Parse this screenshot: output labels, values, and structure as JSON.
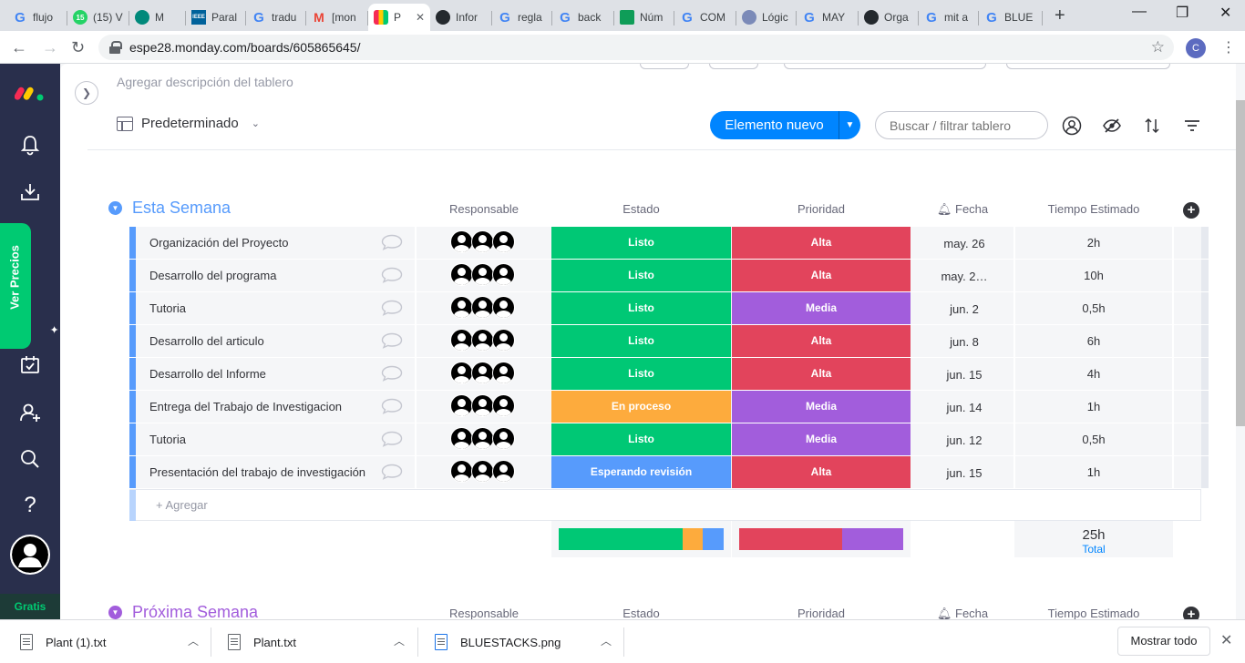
{
  "browser": {
    "tabs": [
      {
        "label": "flujo",
        "icon": "google-icon",
        "glyph": "G",
        "fav": "fav-g"
      },
      {
        "label": "(15) V",
        "icon": "whatsapp-icon",
        "glyph": "15",
        "fav": "fav-wa"
      },
      {
        "label": "M",
        "icon": "chat-icon",
        "glyph": "",
        "fav": "fav-chat"
      },
      {
        "label": "Paral",
        "icon": "ieee-icon",
        "glyph": "IEEE",
        "fav": "fav-ieee"
      },
      {
        "label": "tradu",
        "icon": "google-icon",
        "glyph": "G",
        "fav": "fav-g"
      },
      {
        "label": "[mon",
        "icon": "gmail-icon",
        "glyph": "M",
        "fav": "fav-m"
      },
      {
        "label": "P",
        "icon": "monday-icon",
        "glyph": "",
        "fav": "fav-mon",
        "active": true
      },
      {
        "label": "Infor",
        "icon": "github-icon",
        "glyph": "",
        "fav": "fav-gh"
      },
      {
        "label": "regla",
        "icon": "google-icon",
        "glyph": "G",
        "fav": "fav-g"
      },
      {
        "label": "back",
        "icon": "google-icon",
        "glyph": "G",
        "fav": "fav-g"
      },
      {
        "label": "Núm",
        "icon": "sheets-icon",
        "glyph": "",
        "fav": "fav-sheet"
      },
      {
        "label": "COM",
        "icon": "google-icon",
        "glyph": "G",
        "fav": "fav-g"
      },
      {
        "label": "Lógic",
        "icon": "globe-icon",
        "glyph": "",
        "fav": "fav-globe"
      },
      {
        "label": "MAY",
        "icon": "google-icon",
        "glyph": "G",
        "fav": "fav-g"
      },
      {
        "label": "Orga",
        "icon": "github-icon",
        "glyph": "",
        "fav": "fav-gh"
      },
      {
        "label": "mit a",
        "icon": "google-icon",
        "glyph": "G",
        "fav": "fav-g"
      },
      {
        "label": "BLUE",
        "icon": "google-icon",
        "glyph": "G",
        "fav": "fav-g"
      }
    ],
    "url": "espe28.monday.com/boards/605865645/",
    "profile_initial": "C",
    "new_tab_glyph": "+",
    "minimize_glyph": "—",
    "maximize_glyph": "❐",
    "close_glyph": "✕"
  },
  "sidebar": {
    "upgrade_label": "Ver Precios",
    "plan_label": "Gratis",
    "help_glyph": "?"
  },
  "board": {
    "description_placeholder": "Agregar descripción del tablero",
    "view_name": "Predeterminado",
    "new_item_label": "Elemento nuevo",
    "search_placeholder": "Buscar / filtrar tablero"
  },
  "columns": {
    "owner": "Responsable",
    "status": "Estado",
    "priority": "Prioridad",
    "date": "Fecha",
    "time": "Tiempo Estimado"
  },
  "colors": {
    "status_done": "#00c875",
    "status_working": "#fdab3d",
    "status_waiting": "#579bfc",
    "priority_high": "#e2445c",
    "priority_medium": "#a25ddc",
    "group1": "#579bfc",
    "group2": "#a25ddc"
  },
  "groups": [
    {
      "title": "Esta Semana",
      "add_label": "+ Agregar",
      "rows": [
        {
          "name": "Organización del Proyecto",
          "status": "Listo",
          "status_color": "#00c875",
          "priority": "Alta",
          "priority_color": "#e2445c",
          "date": "may. 26",
          "time": "2h"
        },
        {
          "name": "Desarrollo del programa",
          "status": "Listo",
          "status_color": "#00c875",
          "priority": "Alta",
          "priority_color": "#e2445c",
          "date": "may. 2…",
          "time": "10h"
        },
        {
          "name": "Tutoria",
          "status": "Listo",
          "status_color": "#00c875",
          "priority": "Media",
          "priority_color": "#a25ddc",
          "date": "jun. 2",
          "time": "0,5h"
        },
        {
          "name": "Desarrollo del articulo",
          "status": "Listo",
          "status_color": "#00c875",
          "priority": "Alta",
          "priority_color": "#e2445c",
          "date": "jun. 8",
          "time": "6h"
        },
        {
          "name": "Desarrollo del Informe",
          "status": "Listo",
          "status_color": "#00c875",
          "priority": "Alta",
          "priority_color": "#e2445c",
          "date": "jun. 15",
          "time": "4h"
        },
        {
          "name": "Entrega del Trabajo de Investigacion",
          "status": "En proceso",
          "status_color": "#fdab3d",
          "priority": "Media",
          "priority_color": "#a25ddc",
          "date": "jun. 14",
          "time": "1h"
        },
        {
          "name": "Tutoria",
          "status": "Listo",
          "status_color": "#00c875",
          "priority": "Media",
          "priority_color": "#a25ddc",
          "date": "jun. 12",
          "time": "0,5h"
        },
        {
          "name": "Presentación del trabajo de investigación",
          "status": "Esperando revisión",
          "status_color": "#579bfc",
          "priority": "Alta",
          "priority_color": "#e2445c",
          "date": "jun. 15",
          "time": "1h"
        }
      ],
      "summary": {
        "status_distribution": [
          {
            "label": "Listo",
            "fraction": 0.75,
            "color": "#00c875"
          },
          {
            "label": "En proceso",
            "fraction": 0.125,
            "color": "#fdab3d"
          },
          {
            "label": "Esperando revisión",
            "fraction": 0.125,
            "color": "#579bfc"
          }
        ],
        "priority_distribution": [
          {
            "label": "Alta",
            "fraction": 0.625,
            "color": "#e2445c"
          },
          {
            "label": "Media",
            "fraction": 0.375,
            "color": "#a25ddc"
          }
        ],
        "time_total": "25h",
        "time_total_label": "Total"
      }
    },
    {
      "title": "Próxima Semana"
    }
  ],
  "downloads": {
    "items": [
      {
        "name": "Plant (1).txt"
      },
      {
        "name": "Plant.txt"
      },
      {
        "name": "BLUESTACKS.png"
      }
    ],
    "show_all_label": "Mostrar todo",
    "close_glyph": "✕"
  }
}
